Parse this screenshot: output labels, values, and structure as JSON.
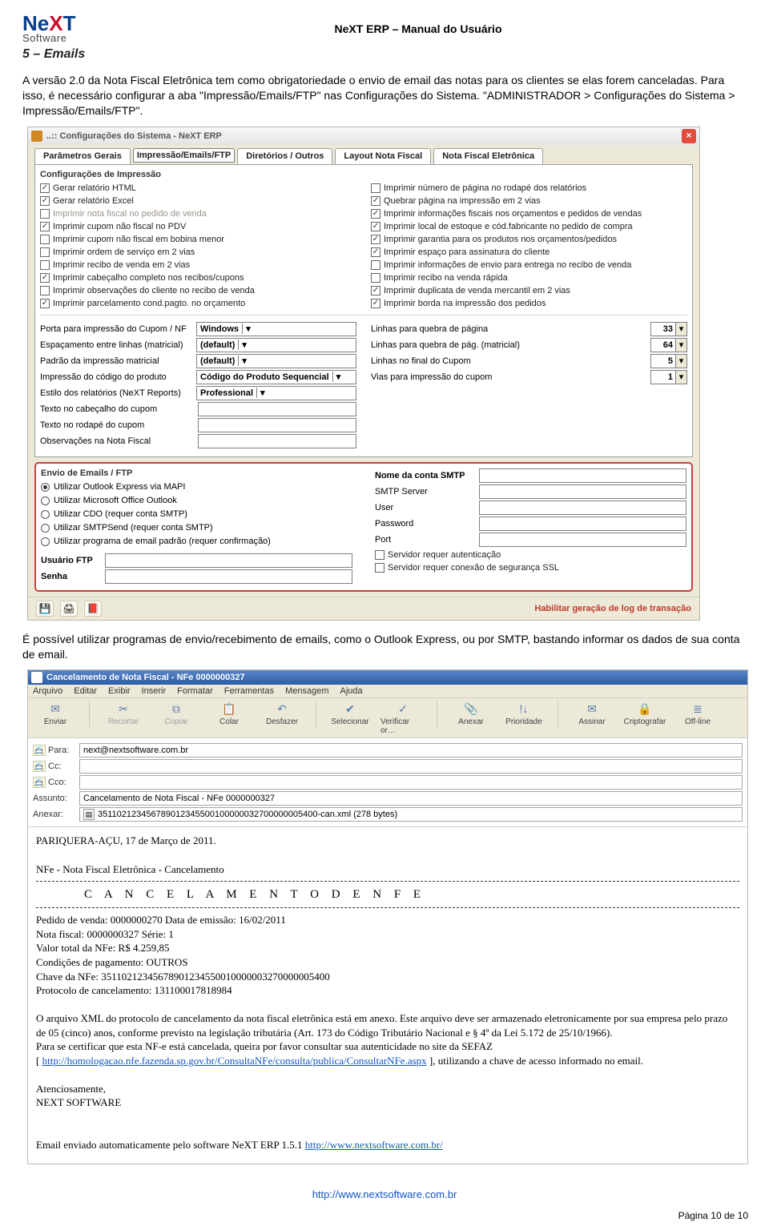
{
  "header": {
    "doc_title": "NeXT ERP – Manual do Usuário",
    "logo_top": "NeXT",
    "logo_sub": "Software",
    "section": "5 – Emails"
  },
  "p1": "A versão 2.0 da Nota Fiscal Eletrônica tem como obrigatoriedade o envio de email das notas para os clientes se elas forem canceladas. Para isso, é necessário configurar a aba \"Impressão/Emails/FTP\" nas Configurações do Sistema. \"ADMINISTRADOR > Configurações do Sistema > Impressão/Emails/FTP\".",
  "p2": "É possível utilizar programas de envio/recebimento de emails, como o Outlook Express, ou por SMTP, bastando informar os dados de sua conta de email.",
  "cfgwin": {
    "title": "..:: Configurações do Sistema - NeXT ERP",
    "tabs": [
      "Parâmetros Gerais",
      "Impressão/Emails/FTP",
      "Diretórios / Outros",
      "Layout Nota Fiscal",
      "Nota Fiscal Eletrônica"
    ],
    "group_print": "Configurações de Impressão",
    "left": [
      {
        "c": true,
        "t": "Gerar relatório HTML"
      },
      {
        "c": true,
        "t": "Gerar relatório Excel"
      },
      {
        "c": false,
        "t": "Imprimir nota fiscal no pedido de venda",
        "d": true
      },
      {
        "c": true,
        "t": "Imprimir cupom não fiscal no PDV"
      },
      {
        "c": false,
        "t": "Imprimir cupom não fiscal em bobina menor"
      },
      {
        "c": false,
        "t": "Imprimir ordem de serviço em 2 vias"
      },
      {
        "c": false,
        "t": "Imprimir recibo de venda em 2 vias"
      },
      {
        "c": true,
        "t": "Imprimir cabeçalho completo nos recibos/cupons"
      },
      {
        "c": false,
        "t": "Imprimir observações do cliente no recibo de venda"
      },
      {
        "c": true,
        "t": "Imprimir parcelamento cond.pagto. no orçamento"
      }
    ],
    "right": [
      {
        "c": false,
        "t": "Imprimir número de página no rodapé dos relatórios"
      },
      {
        "c": true,
        "t": "Quebrar página na impressão em 2 vias"
      },
      {
        "c": true,
        "t": "Imprimir informações fiscais nos orçamentos e pedidos de vendas"
      },
      {
        "c": true,
        "t": "Imprimir local de estoque e cód.fabricante no pedido de compra"
      },
      {
        "c": true,
        "t": "Imprimir garantia para os produtos nos orçamentos/pedidos"
      },
      {
        "c": true,
        "t": "Imprimir espaço para assinatura do cliente"
      },
      {
        "c": false,
        "t": "Imprimir informações de envio para entrega no recibo de venda"
      },
      {
        "c": false,
        "t": "Imprimir recibo na venda rápida"
      },
      {
        "c": true,
        "t": "Imprimir duplicata de venda mercantil em 2 vias"
      },
      {
        "c": true,
        "t": "Imprimir borda na impressão dos pedidos"
      }
    ],
    "selrows": [
      {
        "l": "Porta para impressão do Cupom / NF",
        "v": "Windows"
      },
      {
        "l": "Espaçamento entre linhas (matricial)",
        "v": "(default)"
      },
      {
        "l": "Padrão da impressão matricial",
        "v": "(default)"
      },
      {
        "l": "Impressão do código do produto",
        "v": "Código do Produto Sequencial"
      },
      {
        "l": "Estilo dos relatórios (NeXT Reports)",
        "v": "Professional"
      },
      {
        "l": "Texto no cabeçalho do cupom",
        "v": ""
      },
      {
        "l": "Texto no rodapé do cupom",
        "v": ""
      },
      {
        "l": "Observações na Nota Fiscal",
        "v": ""
      }
    ],
    "numrows": [
      {
        "l": "Linhas para quebra de página",
        "v": "33"
      },
      {
        "l": "Linhas para quebra de pág. (matricial)",
        "v": "64"
      },
      {
        "l": "Linhas no final do Cupom",
        "v": "5"
      },
      {
        "l": "Vias para impressão do cupom",
        "v": "1"
      }
    ],
    "group_email": "Envio de Emails / FTP",
    "radios": [
      {
        "s": true,
        "t": "Utilizar Outlook Express via MAPI"
      },
      {
        "s": false,
        "t": "Utilizar Microsoft Office Outlook"
      },
      {
        "s": false,
        "t": "Utilizar CDO (requer conta SMTP)"
      },
      {
        "s": false,
        "t": "Utilizar SMTPSend (requer conta SMTP)"
      },
      {
        "s": false,
        "t": "Utilizar programa de email padrão (requer confirmação)"
      }
    ],
    "ftp": [
      {
        "l": "Usuário FTP"
      },
      {
        "l": "Senha"
      }
    ],
    "smtp": [
      {
        "l": "Nome da conta SMTP"
      },
      {
        "l": "SMTP Server"
      },
      {
        "l": "User"
      },
      {
        "l": "Password"
      },
      {
        "l": "Port"
      }
    ],
    "smtpchk": [
      {
        "c": false,
        "t": "Servidor requer autenticação"
      },
      {
        "c": false,
        "t": "Servidor requer conexão de segurança SSL"
      }
    ],
    "loglink": "Habilitar geração de log de transação"
  },
  "mail": {
    "title": "Cancelamento de Nota Fiscal - NFe 0000000327",
    "menu": [
      "Arquivo",
      "Editar",
      "Exibir",
      "Inserir",
      "Formatar",
      "Ferramentas",
      "Mensagem",
      "Ajuda"
    ],
    "tbar": [
      {
        "i": "✉",
        "l": "Enviar",
        "e": true
      },
      {
        "i": "✂",
        "l": "Recortar",
        "e": false
      },
      {
        "i": "⧉",
        "l": "Copiar",
        "e": false
      },
      {
        "i": "📋",
        "l": "Colar",
        "e": true
      },
      {
        "i": "↶",
        "l": "Desfazer",
        "e": true
      },
      {
        "i": "✔",
        "l": "Selecionar",
        "e": true
      },
      {
        "i": "✓",
        "l": "Verificar or…",
        "e": true
      },
      {
        "i": "📎",
        "l": "Anexar",
        "e": true
      },
      {
        "i": "!↓",
        "l": "Prioridade",
        "e": true
      },
      {
        "i": "✉",
        "l": "Assinar",
        "e": true
      },
      {
        "i": "🔒",
        "l": "Criptografar",
        "e": true
      },
      {
        "i": "≣",
        "l": "Off-line",
        "e": true
      }
    ],
    "hdrs": {
      "para_l": "Para:",
      "para_v": "next@nextsoftware.com.br",
      "cc_l": "Cc:",
      "cc_v": "",
      "cco_l": "Cco:",
      "cco_v": "",
      "ass_l": "Assunto:",
      "ass_v": "Cancelamento de Nota Fiscal - NFe 0000000327",
      "anx_l": "Anexar:",
      "anx_v": "351102123456789012345500100000032700000005400-can.xml (278 bytes)"
    },
    "body": {
      "loc": "PARIQUERA-AÇU, 17 de Março de 2011.",
      "sub": "NFe - Nota Fiscal Eletrônica - Cancelamento",
      "ctitle": "C A N C E L A M E N T O   D E   N F E",
      "lines": [
        "Pedido de venda: 0000000270  Data de emissão: 16/02/2011",
        "Nota fiscal: 0000000327   Série: 1",
        "Valor total da NFe: R$ 4.259,85",
        "Condições de pagamento: OUTROS",
        "Chave da NFe: 35110212345678901234550010000003270000005400",
        "Protocolo de cancelamento: 131100017818984"
      ],
      "para": "O arquivo XML do protocolo de cancelamento da nota fiscal eletrônica está em anexo. Este arquivo deve ser armazenado eletronicamente por sua empresa pelo prazo de 05 (cinco) anos, conforme previsto na legislação tributária (Art. 173 do Código Tributário Nacional e § 4º da Lei 5.172 de 25/10/1966).",
      "para2": "Para se certificar que esta NF-e está cancelada, queira por favor consultar sua autenticidade no site da SEFAZ",
      "link1_pre": "[ ",
      "link1": "http://homologacao.nfe.fazenda.sp.gov.br/ConsultaNFe/consulta/publica/ConsultarNFe.aspx",
      "link1_suf": " ], utilizando a chave de acesso informado no email.",
      "sig1": "Atenciosamente,",
      "sig2": "NEXT SOFTWARE",
      "foot": "Email enviado automaticamente pelo software NeXT ERP 1.5.1 ",
      "footlink": "http://www.nextsoftware.com.br/"
    }
  },
  "footer": {
    "url": "http://www.nextsoftware.com.br",
    "pageno": "Página 10 de 10"
  }
}
